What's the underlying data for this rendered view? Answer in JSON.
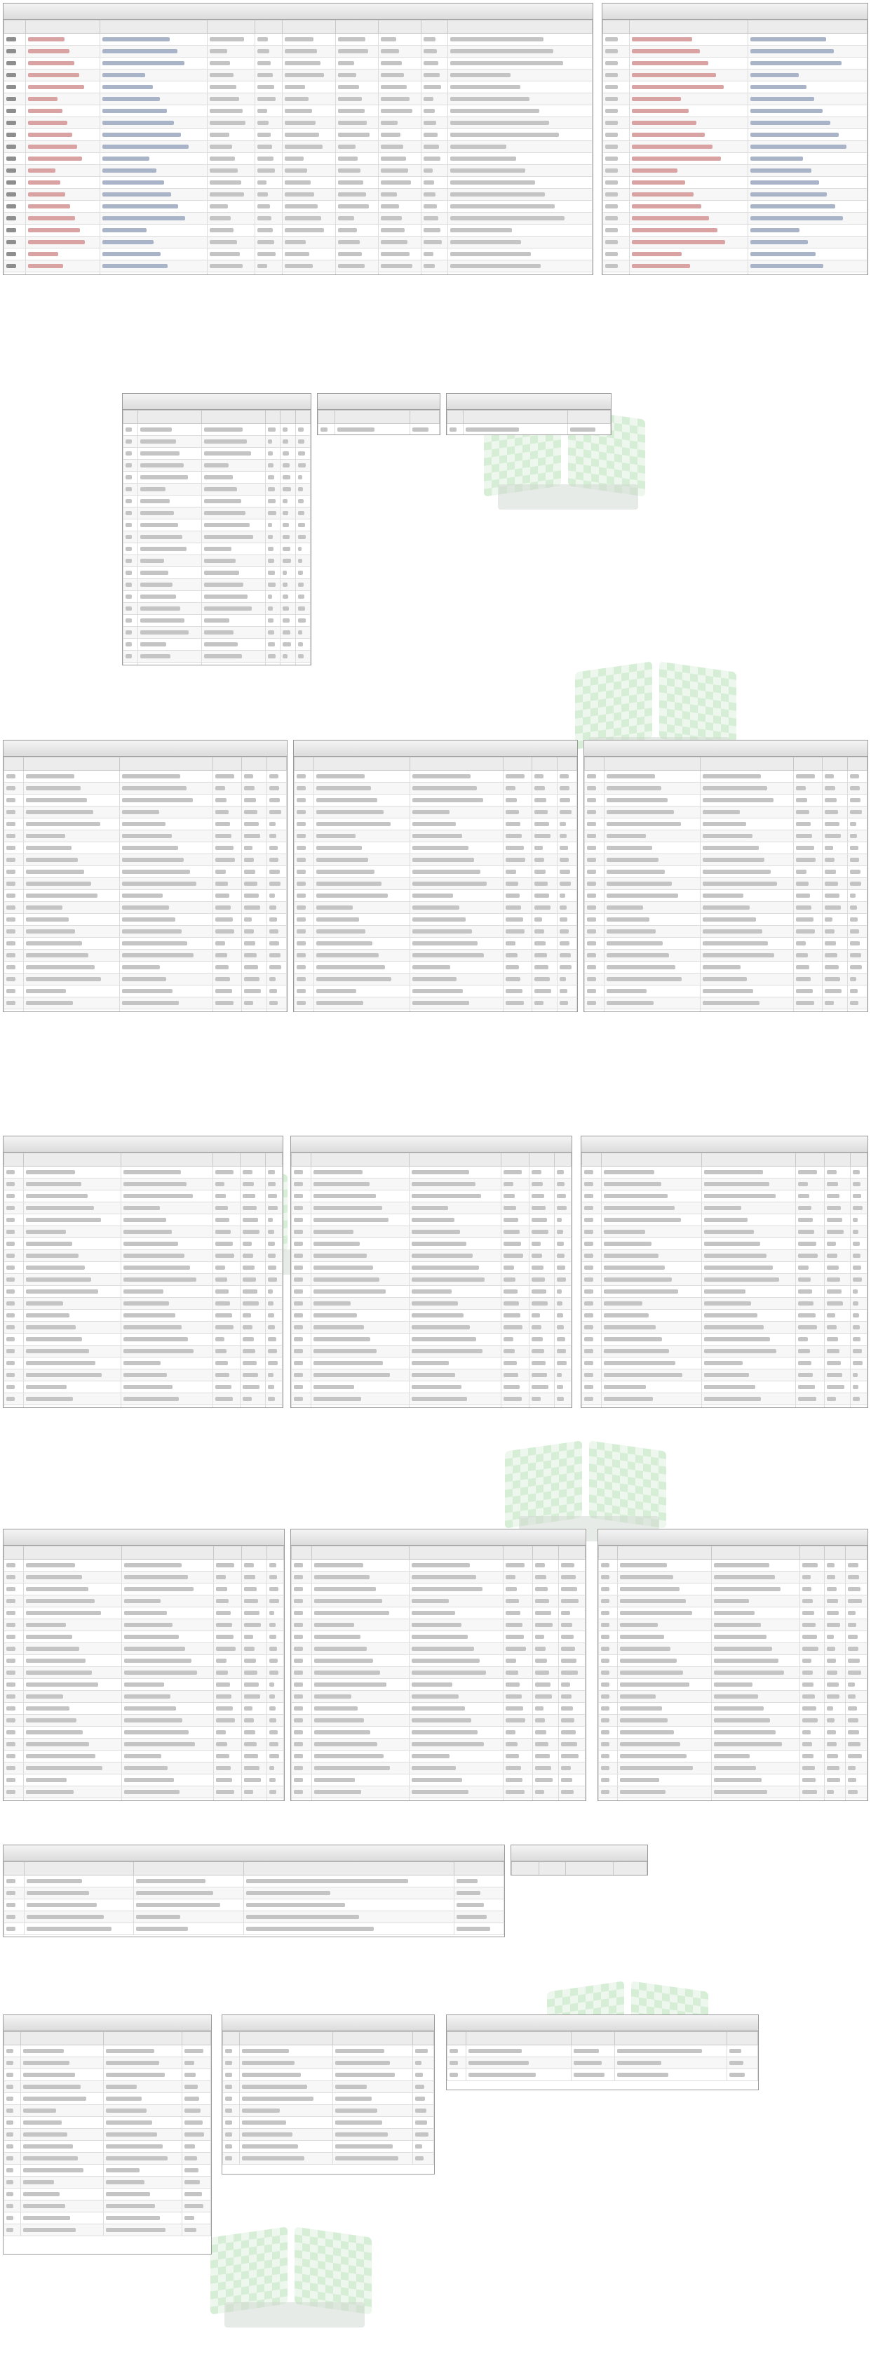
{
  "page": {
    "combined_best_lap_label": "",
    "combined_best_lap_value": ""
  },
  "panels": {
    "race_results": {
      "title": "",
      "columns": [
        "",
        "",
        "",
        "",
        "",
        "",
        "",
        "",
        "",
        ""
      ],
      "row_count": 22
    },
    "start_order": {
      "title": "",
      "columns": [
        "",
        "",
        ""
      ],
      "row_count": 22
    },
    "highest_climber": {
      "title": "",
      "columns": [
        "",
        "",
        "",
        "",
        "",
        ""
      ],
      "row_count": 22
    },
    "race_leader": {
      "title": "",
      "columns": [
        "",
        "",
        ""
      ],
      "row_count": 2
    },
    "laps_led": {
      "title": "",
      "columns": [
        "",
        "",
        ""
      ],
      "row_count": 2
    },
    "lap_time_stability": {
      "title": "",
      "columns": [
        "",
        "",
        "",
        "",
        "",
        ""
      ],
      "row_count": 22
    },
    "average_lap": {
      "title": "",
      "columns": [
        "",
        "",
        "",
        "",
        "",
        ""
      ],
      "row_count": 22
    },
    "first_lap": {
      "title": "",
      "columns": [
        "",
        "",
        "",
        "",
        "",
        ""
      ],
      "row_count": 22
    },
    "best_split_1": {
      "title": "",
      "columns": [
        "",
        "",
        "",
        "",
        "",
        ""
      ],
      "row_count": 22
    },
    "best_split_2": {
      "title": "",
      "columns": [
        "",
        "",
        "",
        "",
        "",
        ""
      ],
      "row_count": 22
    },
    "best_split_3": {
      "title": "",
      "columns": [
        "",
        "",
        "",
        "",
        "",
        ""
      ],
      "row_count": 22
    },
    "best_lap": {
      "title": "",
      "columns": [
        "",
        "",
        "",
        "",
        "",
        ""
      ],
      "row_count": 22
    },
    "best_possible_lap": {
      "title": "",
      "columns": [
        "",
        "",
        "",
        "",
        "",
        ""
      ],
      "row_count": 22
    },
    "top_speed": {
      "title": "",
      "columns": [
        "",
        "",
        "",
        "",
        "",
        ""
      ],
      "row_count": 22
    },
    "pit_stops": {
      "title": "",
      "columns": [
        "",
        "",
        "",
        "",
        ""
      ],
      "row_count": 5
    },
    "take_over_car": {
      "title": "",
      "columns": [
        "",
        "",
        "",
        ""
      ],
      "row_count": 0
    },
    "yellow_flags": {
      "title": "",
      "columns": [
        "",
        "",
        "",
        ""
      ],
      "row_count": 16
    },
    "blue_flags": {
      "title": "",
      "columns": [
        "",
        "",
        "",
        ""
      ],
      "row_count": 10
    },
    "penalties": {
      "title": "",
      "columns": [
        "",
        "",
        "",
        "",
        ""
      ],
      "row_count": 3
    }
  },
  "colors": {
    "header_bg": "#dcdcdc",
    "border": "#9a9a9a",
    "watermark": "#b5dfb5"
  }
}
